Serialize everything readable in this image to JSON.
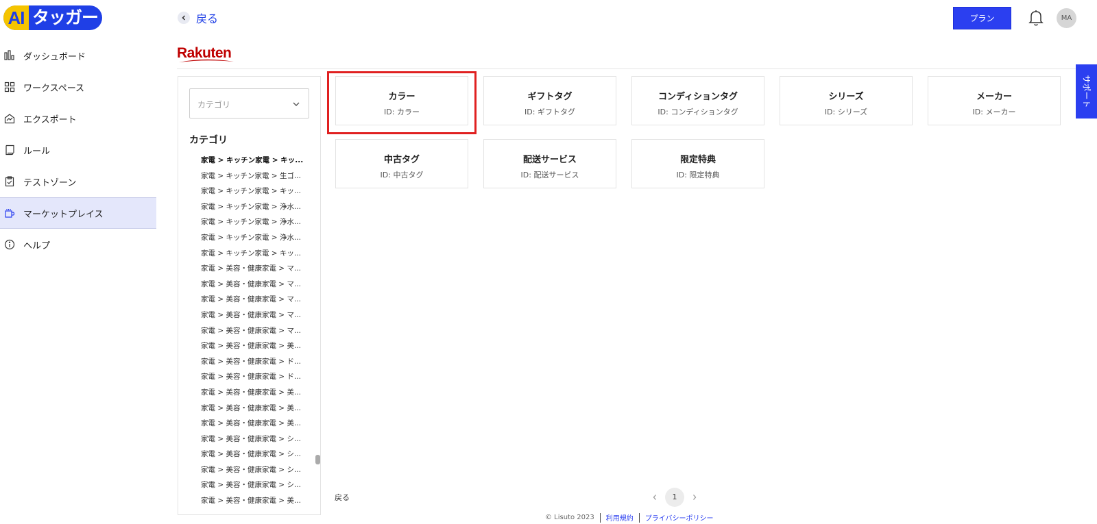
{
  "logo": {
    "ai": "AI",
    "name": "タッガー"
  },
  "sidebar": {
    "items": [
      {
        "label": "ダッシュボード",
        "icon": "bar-chart-icon"
      },
      {
        "label": "ワークスペース",
        "icon": "grid-icon"
      },
      {
        "label": "エクスポート",
        "icon": "export-icon"
      },
      {
        "label": "ルール",
        "icon": "scroll-icon"
      },
      {
        "label": "テストゾーン",
        "icon": "clipboard-check-icon"
      },
      {
        "label": "マーケットプレイス",
        "icon": "store-icon",
        "active": true
      },
      {
        "label": "ヘルプ",
        "icon": "info-icon"
      }
    ]
  },
  "header": {
    "back_label": "戻る",
    "plan_label": "プラン",
    "avatar_initials": "MA"
  },
  "marketplace": {
    "brand": "Rakuten",
    "brand_color": "#bf0000"
  },
  "category_panel": {
    "select_placeholder": "カテゴリ",
    "title": "カテゴリ",
    "items": [
      "家電 > キッチン家電 > キッ...",
      "家電 > キッチン家電 > 生ゴ...",
      "家電 > キッチン家電 > キッ...",
      "家電 > キッチン家電 > 浄水...",
      "家電 > キッチン家電 > 浄水...",
      "家電 > キッチン家電 > 浄水...",
      "家電 > キッチン家電 > キッ...",
      "家電 > 美容・健康家電 > マ...",
      "家電 > 美容・健康家電 > マ...",
      "家電 > 美容・健康家電 > マ...",
      "家電 > 美容・健康家電 > マ...",
      "家電 > 美容・健康家電 > マ...",
      "家電 > 美容・健康家電 > 美...",
      "家電 > 美容・健康家電 > ド...",
      "家電 > 美容・健康家電 > ド...",
      "家電 > 美容・健康家電 > 美...",
      "家電 > 美容・健康家電 > 美...",
      "家電 > 美容・健康家電 > 美...",
      "家電 > 美容・健康家電 > シ...",
      "家電 > 美容・健康家電 > シ...",
      "家電 > 美容・健康家電 > シ...",
      "家電 > 美容・健康家電 > シ...",
      "家電 > 美容・健康家電 > 美..."
    ]
  },
  "tag_cards": [
    {
      "title": "カラー",
      "id": "ID: カラー",
      "selected": true
    },
    {
      "title": "ギフトタグ",
      "id": "ID: ギフトタグ"
    },
    {
      "title": "コンディションタグ",
      "id": "ID: コンディションタグ"
    },
    {
      "title": "シリーズ",
      "id": "ID: シリーズ"
    },
    {
      "title": "メーカー",
      "id": "ID: メーカー"
    },
    {
      "title": "中古タグ",
      "id": "ID: 中古タグ"
    },
    {
      "title": "配送サービス",
      "id": "ID: 配送サービス"
    },
    {
      "title": "限定特典",
      "id": "ID: 限定特典"
    }
  ],
  "support_label": "サポート",
  "pagination": {
    "back_label": "戻る",
    "current_page": "1"
  },
  "footer": {
    "copyright": "© Lisuto 2023",
    "terms": "利用規約",
    "privacy": "プライバシーポリシー"
  },
  "colors": {
    "accent": "#2b3ff0",
    "logo_yellow": "#f5c400",
    "highlight": "#e02020",
    "active_nav": "#e4e7fb"
  }
}
